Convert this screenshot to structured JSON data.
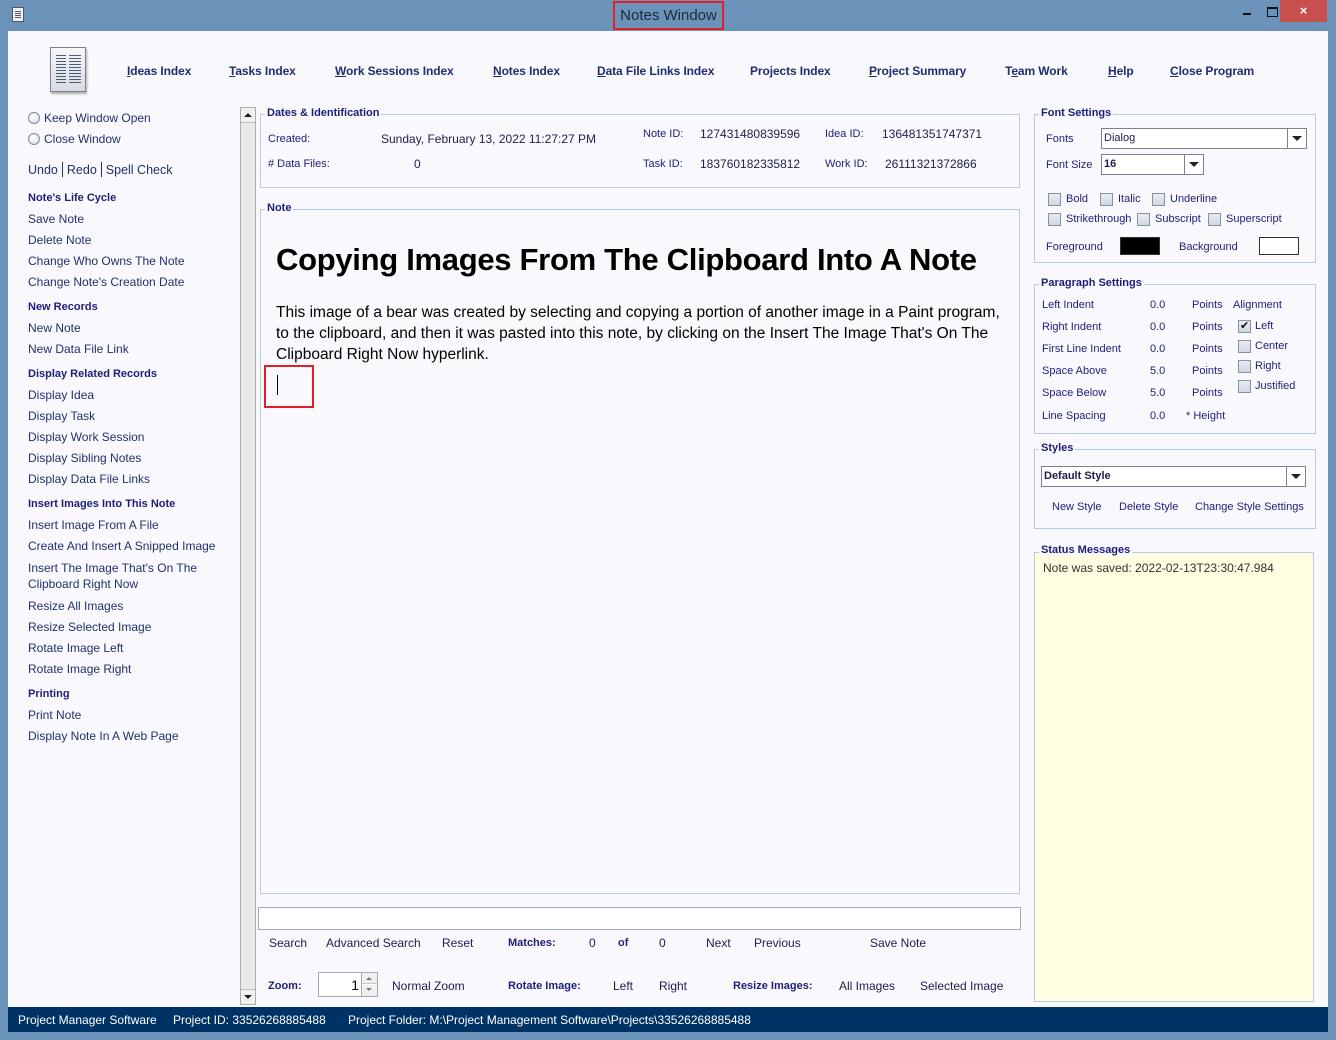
{
  "window": {
    "title": "Notes Window",
    "close_glyph": "×"
  },
  "top_nav": [
    {
      "label": "Ideas Index",
      "mnemonic": "I"
    },
    {
      "label": "Tasks Index",
      "mnemonic": "T"
    },
    {
      "label": "Work Sessions Index",
      "mnemonic": "W"
    },
    {
      "label": "Notes Index",
      "mnemonic": "N"
    },
    {
      "label": "Data File Links Index",
      "mnemonic": "D"
    },
    {
      "label": "Projects Index",
      "mnemonic": ""
    },
    {
      "label": "Project Summary",
      "mnemonic": "P"
    },
    {
      "label": "Team Work",
      "mnemonic": "e"
    },
    {
      "label": "Help",
      "mnemonic": "H"
    },
    {
      "label": "Close Program",
      "mnemonic": "C"
    }
  ],
  "sidebar": {
    "radio_keep_open": "Keep Window Open",
    "radio_close": "Close Window",
    "undo": "Undo",
    "redo": "Redo",
    "spell_check": "Spell Check",
    "sections": [
      {
        "heading": "Note's Life Cycle",
        "items": [
          "Save Note",
          "Delete Note",
          "Change Who Owns The Note",
          "Change Note's Creation Date"
        ]
      },
      {
        "heading": "New Records",
        "items": [
          "New Note",
          "New Data File Link"
        ]
      },
      {
        "heading": "Display Related Records",
        "items": [
          "Display Idea",
          "Display Task",
          "Display Work Session",
          "Display Sibling Notes",
          "Display Data File Links"
        ]
      },
      {
        "heading": "Insert Images Into This Note",
        "items": [
          "Insert Image From A File",
          "Create And Insert A Snipped Image",
          "Insert The Image That's On The",
          "Clipboard Right Now",
          "Resize All Images",
          "Resize Selected Image",
          "Rotate Image Left",
          "Rotate Image Right"
        ]
      },
      {
        "heading": "Printing",
        "items": [
          "Print Note",
          "Display Note In A Web Page"
        ]
      }
    ]
  },
  "dates_identification": {
    "title": "Dates & Identification",
    "created_label": "Created:",
    "created_value": "Sunday, February 13, 2022   11:27:27 PM",
    "data_files_label": "# Data Files:",
    "data_files_value": "0",
    "note_id_label": "Note ID:",
    "note_id_value": "127431480839596",
    "idea_id_label": "Idea ID:",
    "idea_id_value": "136481351747371",
    "task_id_label": "Task ID:",
    "task_id_value": "183760182335812",
    "work_id_label": "Work ID:",
    "work_id_value": "26111321372866"
  },
  "note": {
    "title": "Note",
    "heading": "Copying Images From The Clipboard Into A Note",
    "body": "This image of a bear was created by selecting and copying a portion of another image in a Paint program, to the clipboard, and then it was pasted into this note, by clicking on the Insert The Image That's On The Clipboard Right Now hyperlink."
  },
  "search_bar": {
    "value": "",
    "search": "Search",
    "advanced_search": "Advanced Search",
    "reset": "Reset",
    "matches_label": "Matches:",
    "matches_current": "0",
    "of_label": "of",
    "matches_total": "0",
    "next": "Next",
    "previous": "Previous",
    "save_note": "Save Note"
  },
  "bottom_bar": {
    "zoom_label": "Zoom:",
    "zoom_value": "1",
    "normal_zoom": "Normal Zoom",
    "rotate_label": "Rotate Image:",
    "rotate_left": "Left",
    "rotate_right": "Right",
    "resize_label": "Resize Images:",
    "resize_all": "All Images",
    "resize_selected": "Selected Image"
  },
  "font_settings": {
    "title": "Font Settings",
    "fonts_label": "Fonts",
    "font_value": "Dialog",
    "size_label": "Font Size",
    "size_value": "16",
    "bold": "Bold",
    "italic": "Italic",
    "underline": "Underline",
    "strikethrough": "Strikethrough",
    "subscript": "Subscript",
    "superscript": "Superscript",
    "foreground_label": "Foreground",
    "foreground_color": "#000000",
    "background_label": "Background",
    "background_color": "#ffffff"
  },
  "paragraph_settings": {
    "title": "Paragraph Settings",
    "rows": [
      {
        "label": "Left Indent",
        "value": "0.0",
        "unit": "Points"
      },
      {
        "label": "Right Indent",
        "value": "0.0",
        "unit": "Points"
      },
      {
        "label": "First Line Indent",
        "value": "0.0",
        "unit": "Points"
      },
      {
        "label": "Space Above",
        "value": "5.0",
        "unit": "Points"
      },
      {
        "label": "Space Below",
        "value": "5.0",
        "unit": "Points"
      },
      {
        "label": "Line Spacing",
        "value": "0.0",
        "unit": "* Height"
      }
    ],
    "alignment_label": "Alignment",
    "alignments": [
      {
        "label": "Left",
        "checked": true
      },
      {
        "label": "Center",
        "checked": false
      },
      {
        "label": "Right",
        "checked": false
      },
      {
        "label": "Justified",
        "checked": false
      }
    ]
  },
  "styles": {
    "title": "Styles",
    "selected": "Default Style",
    "new_style": "New Style",
    "delete_style": "Delete Style",
    "change_style": "Change Style Settings"
  },
  "status": {
    "title": "Status Messages",
    "message": "Note was saved:  2022-02-13T23:30:47.984"
  },
  "footer": {
    "app_name": "Project Manager Software",
    "project_id": "Project ID:  33526268885488",
    "project_folder": "Project Folder: M:\\Project Management Software\\Projects\\33526268885488"
  },
  "colors": {
    "title_bar": "#6b93b9",
    "footer_bg": "#003365",
    "link_text": "#1f2e6e",
    "status_bg": "#fffee0",
    "highlight_box": "#e21f26"
  }
}
